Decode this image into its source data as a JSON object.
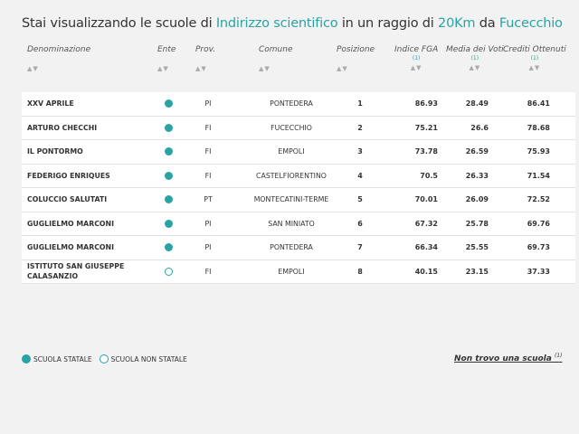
{
  "title": {
    "prefix": "Stai visualizzando le scuole di ",
    "indirizzo": "Indirizzo scientifico",
    "middle": " in un raggio di ",
    "raggio": "20Km",
    "da": " da ",
    "citta": "Fucecchio"
  },
  "columns": {
    "denominazione": "Denominazione",
    "ente": "Ente",
    "prov": "Prov.",
    "comune": "Comune",
    "posizione": "Posizione",
    "fga": "Indice FGA",
    "media": "Media dei Voti",
    "crediti": "Crediti Ottenuti",
    "note": "(1)",
    "sort": "▲▼"
  },
  "rows": [
    {
      "name": "XXV APRILE",
      "statale": true,
      "prov": "PI",
      "comune": "PONTEDERA",
      "pos": "1",
      "fga": "86.93",
      "media": "28.49",
      "crediti": "86.41"
    },
    {
      "name": "ARTURO CHECCHI",
      "statale": true,
      "prov": "FI",
      "comune": "FUCECCHIO",
      "pos": "2",
      "fga": "75.21",
      "media": "26.6",
      "crediti": "78.68"
    },
    {
      "name": "IL PONTORMO",
      "statale": true,
      "prov": "FI",
      "comune": "EMPOLI",
      "pos": "3",
      "fga": "73.78",
      "media": "26.59",
      "crediti": "75.93"
    },
    {
      "name": "FEDERIGO ENRIQUES",
      "statale": true,
      "prov": "FI",
      "comune": "CASTELFIORENTINO",
      "pos": "4",
      "fga": "70.5",
      "media": "26.33",
      "crediti": "71.54"
    },
    {
      "name": "COLUCCIO SALUTATI",
      "statale": true,
      "prov": "PT",
      "comune": "MONTECATINI-TERME",
      "pos": "5",
      "fga": "70.01",
      "media": "26.09",
      "crediti": "72.52"
    },
    {
      "name": "GUGLIELMO MARCONI",
      "statale": true,
      "prov": "PI",
      "comune": "SAN MINIATO",
      "pos": "6",
      "fga": "67.32",
      "media": "25.78",
      "crediti": "69.76"
    },
    {
      "name": "GUGLIELMO MARCONI",
      "statale": true,
      "prov": "PI",
      "comune": "PONTEDERA",
      "pos": "7",
      "fga": "66.34",
      "media": "25.55",
      "crediti": "69.73"
    },
    {
      "name": "ISTITUTO SAN GIUSEPPE CALASANZIO",
      "statale": false,
      "prov": "FI",
      "comune": "EMPOLI",
      "pos": "8",
      "fga": "40.15",
      "media": "23.15",
      "crediti": "37.33"
    }
  ],
  "legend": {
    "statale": "SCUOLA STATALE",
    "non_statale": "SCUOLA NON STATALE"
  },
  "not_found": {
    "label": "Non trovo una scuola",
    "note": "(1)"
  },
  "colors": {
    "accent": "#2aa3a3"
  }
}
